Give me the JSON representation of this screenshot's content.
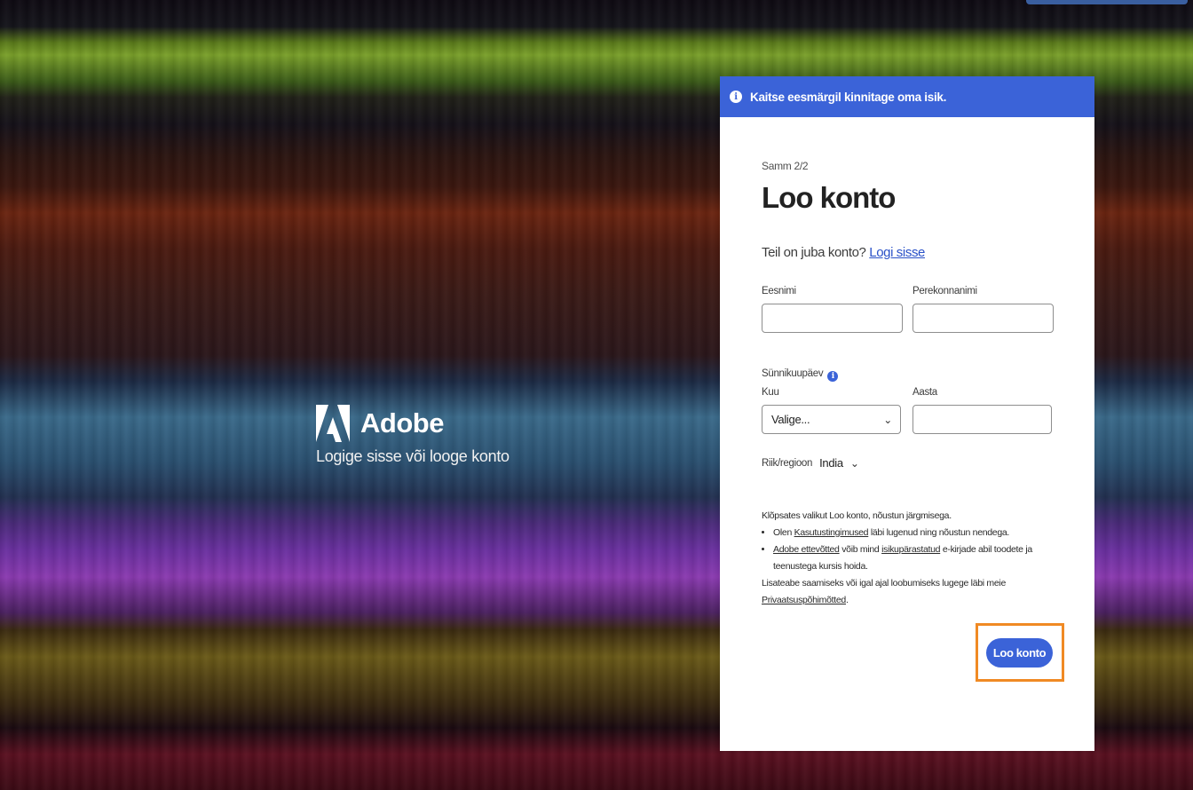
{
  "brand": {
    "name": "Adobe",
    "tagline": "Logige sisse või looge konto"
  },
  "banner": {
    "icon": "info-icon",
    "text": "Kaitse eesmärgil kinnitage oma isik."
  },
  "form": {
    "step": "Samm 2/2",
    "title": "Loo konto",
    "signin_prompt": "Teil on juba konto?",
    "signin_link": "Logi sisse",
    "first_name_label": "Eesnimi",
    "first_name_value": "",
    "last_name_label": "Perekonnanimi",
    "last_name_value": "",
    "birthday_label": "Sünnikuupäev",
    "month_label": "Kuu",
    "month_value": "Valige...",
    "year_label": "Aasta",
    "year_value": "",
    "country_label": "Riik/regioon",
    "country_value": "India",
    "submit_label": "Loo konto"
  },
  "legal": {
    "intro": "Klõpsates valikut Loo konto, nõustun järgmisega.",
    "item1_pre": "Olen ",
    "item1_link": "Kasutustingimused",
    "item1_post": " läbi lugenud ning nõustun nendega.",
    "item2_link1": "Adobe ettevõtted",
    "item2_mid": " võib mind ",
    "item2_link2": "isikupärastatud",
    "item2_post": " e-kirjade abil toodete ja teenustega kursis hoida.",
    "more_pre": "Lisateabe saamiseks või igal ajal loobumiseks lugege läbi meie ",
    "more_link": "Privaatsuspõhimõtted",
    "more_post": "."
  },
  "colors": {
    "accent": "#3b63d8",
    "highlight": "#f08a24"
  }
}
